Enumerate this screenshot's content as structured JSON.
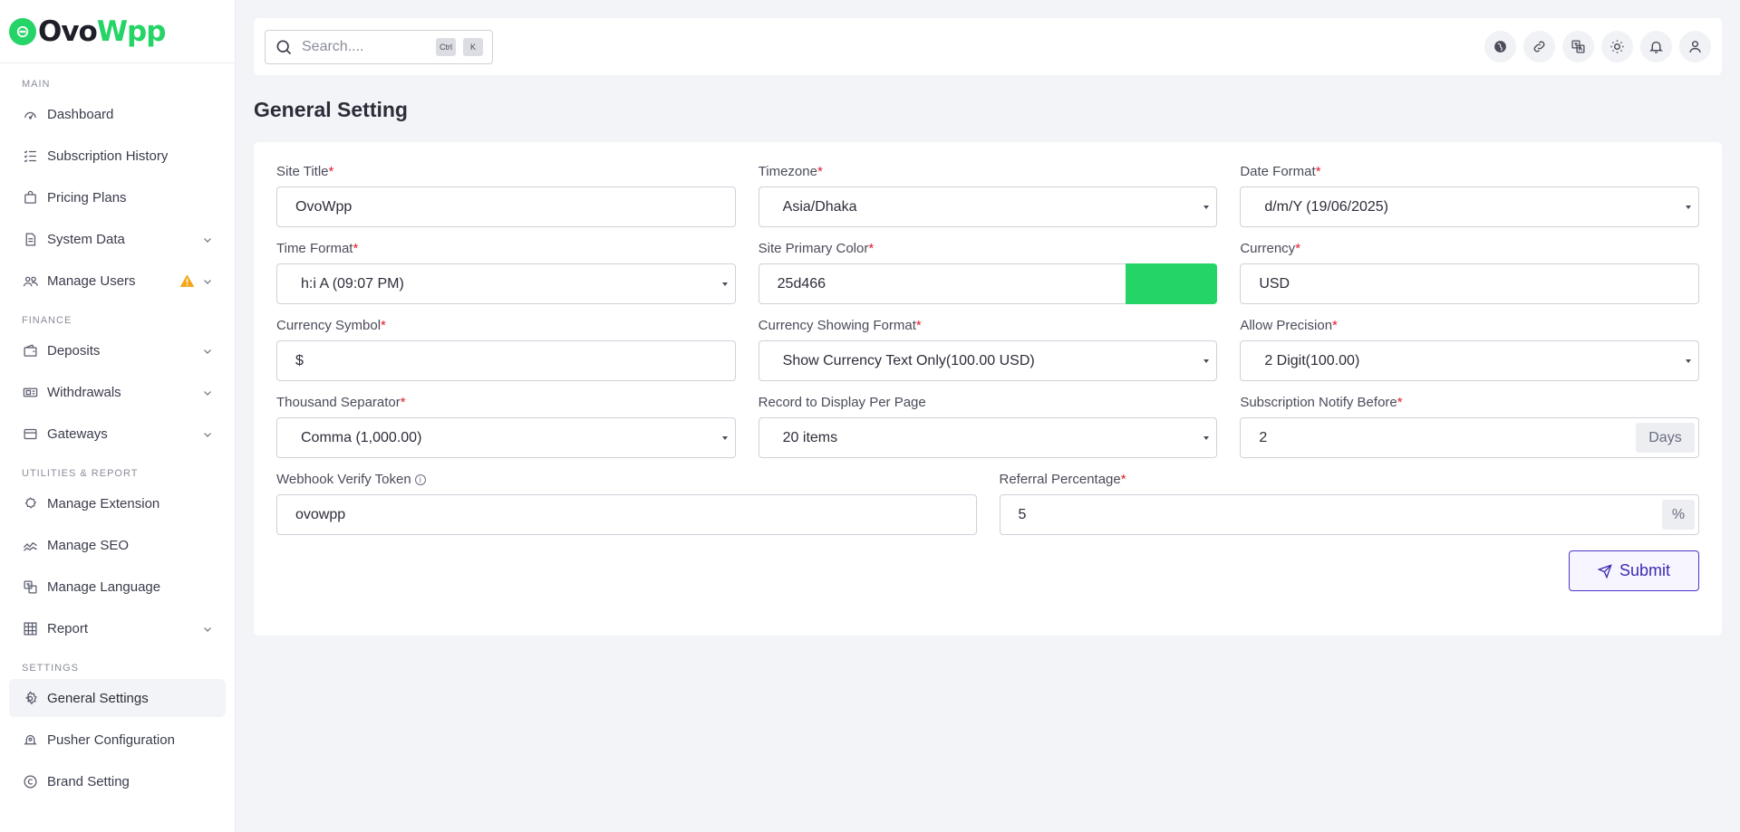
{
  "brand": {
    "part1": "Ovo",
    "part2": "Wpp",
    "accent": "#25d466"
  },
  "sidebar": {
    "sections": [
      {
        "label": "MAIN",
        "items": [
          {
            "label": "Dashboard",
            "icon": "dashboard-icon"
          },
          {
            "label": "Subscription History",
            "icon": "list-check-icon"
          },
          {
            "label": "Pricing Plans",
            "icon": "bag-icon"
          },
          {
            "label": "System Data",
            "icon": "file-icon",
            "chevron": true
          },
          {
            "label": "Manage Users",
            "icon": "users-icon",
            "chevron": true,
            "warning": true
          }
        ]
      },
      {
        "label": "FINANCE",
        "items": [
          {
            "label": "Deposits",
            "icon": "wallet-icon",
            "chevron": true
          },
          {
            "label": "Withdrawals",
            "icon": "money-icon",
            "chevron": true
          },
          {
            "label": "Gateways",
            "icon": "card-icon",
            "chevron": true
          }
        ]
      },
      {
        "label": "UTILITIES & REPORT",
        "items": [
          {
            "label": "Manage Extension",
            "icon": "puzzle-icon"
          },
          {
            "label": "Manage SEO",
            "icon": "chart-line-icon"
          },
          {
            "label": "Manage Language",
            "icon": "language-icon"
          },
          {
            "label": "Report",
            "icon": "grid-icon",
            "chevron": true
          }
        ]
      },
      {
        "label": "SETTINGS",
        "items": [
          {
            "label": "General Settings",
            "icon": "gear-icon",
            "active": true
          },
          {
            "label": "Pusher Configuration",
            "icon": "bell-config-icon"
          },
          {
            "label": "Brand Setting",
            "icon": "copyright-icon"
          }
        ]
      }
    ]
  },
  "topbar": {
    "search_placeholder": "Search....",
    "kbd_ctrl": "Ctrl",
    "kbd_k": "K",
    "icons": [
      "globe-icon",
      "link-icon",
      "translate-icon",
      "sun-icon",
      "bell-icon",
      "user-icon"
    ]
  },
  "page": {
    "title": "General Setting"
  },
  "form": {
    "site_title": {
      "label": "Site Title",
      "value": "OvoWpp"
    },
    "timezone": {
      "label": "Timezone",
      "value": "Asia/Dhaka"
    },
    "date_format": {
      "label": "Date Format",
      "value": "d/m/Y (19/06/2025)"
    },
    "time_format": {
      "label": "Time Format",
      "value": "h:i A (09:07 PM)"
    },
    "primary_color": {
      "label": "Site Primary Color",
      "value": "25d466",
      "swatch": "#25d466"
    },
    "currency": {
      "label": "Currency",
      "value": "USD"
    },
    "currency_symbol": {
      "label": "Currency Symbol",
      "value": "$"
    },
    "currency_format": {
      "label": "Currency Showing Format",
      "value": "Show Currency Text Only(100.00 USD)"
    },
    "precision": {
      "label": "Allow Precision",
      "value": "2 Digit(100.00)"
    },
    "thousand_sep": {
      "label": "Thousand Separator",
      "value": "Comma (1,000.00)"
    },
    "per_page": {
      "label": "Record to Display Per Page",
      "value": "20 items"
    },
    "notify_before": {
      "label": "Subscription Notify Before",
      "value": "2",
      "addon": "Days"
    },
    "webhook_token": {
      "label": "Webhook Verify Token",
      "value": "ovowpp",
      "info": "i"
    },
    "referral": {
      "label": "Referral Percentage",
      "value": "5",
      "addon": "%"
    },
    "required_mark": "*",
    "submit_label": "Submit"
  }
}
